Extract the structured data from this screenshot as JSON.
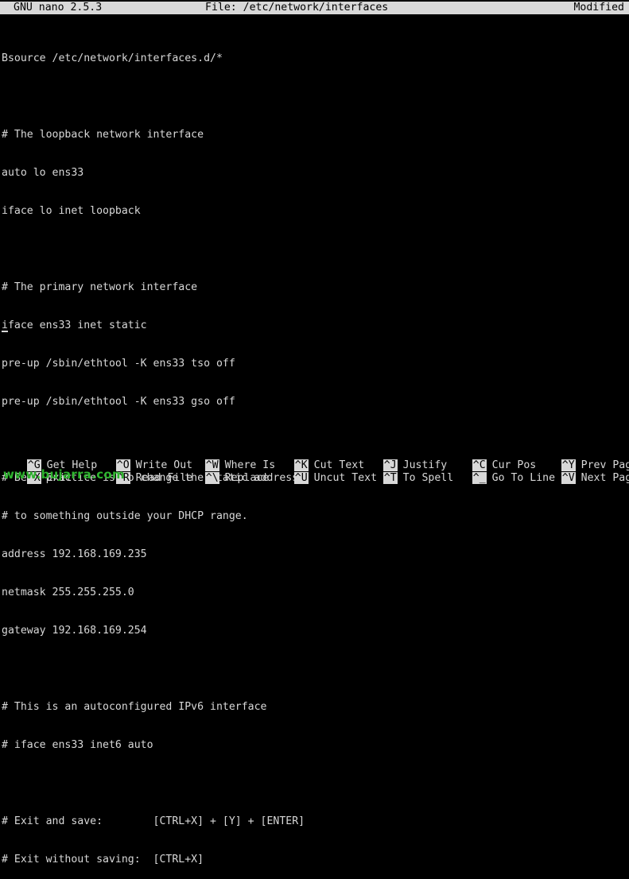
{
  "title_bar": {
    "app": "GNU nano 2.5.3",
    "file": "File: /etc/network/interfaces",
    "status": "Modified"
  },
  "lines": [
    "Bsource /etc/network/interfaces.d/*",
    "",
    "# The loopback network interface",
    "auto lo ens33",
    "iface lo inet loopback",
    "",
    "# The primary network interface",
    "iface ens33 inet static",
    "pre-up /sbin/ethtool -K ens33 tso off",
    "pre-up /sbin/ethtool -K ens33 gso off",
    "",
    "# Best practice is to change the static address",
    "# to something outside your DHCP range.",
    "address 192.168.169.235",
    "netmask 255.255.255.0",
    "gateway 192.168.169.254",
    "",
    "# This is an autoconfigured IPv6 interface",
    "# iface ens33 inet6 auto",
    "",
    "# Exit and save:        [CTRL+X] + [Y] + [ENTER]",
    "# Exit without saving:  [CTRL+X]"
  ],
  "shortcuts": {
    "row1": [
      {
        "key": "^G",
        "label": "Get Help"
      },
      {
        "key": "^O",
        "label": "Write Out"
      },
      {
        "key": "^W",
        "label": "Where Is"
      },
      {
        "key": "^K",
        "label": "Cut Text"
      },
      {
        "key": "^J",
        "label": "Justify"
      },
      {
        "key": "^C",
        "label": "Cur Pos"
      },
      {
        "key": "^Y",
        "label": "Prev Page"
      }
    ],
    "row2": [
      {
        "key": "^X",
        "label": "Exit"
      },
      {
        "key": "^R",
        "label": "Read File"
      },
      {
        "key": "^\\",
        "label": "Replace"
      },
      {
        "key": "^U",
        "label": "Uncut Text"
      },
      {
        "key": "^T",
        "label": "To Spell"
      },
      {
        "key": "^_",
        "label": "Go To Line"
      },
      {
        "key": "^V",
        "label": "Next Page"
      }
    ]
  },
  "watermark": "www.bujarra.com",
  "colors": {
    "background": "#000000",
    "foreground": "#d8d8d8",
    "watermark": "#2fb52f"
  }
}
